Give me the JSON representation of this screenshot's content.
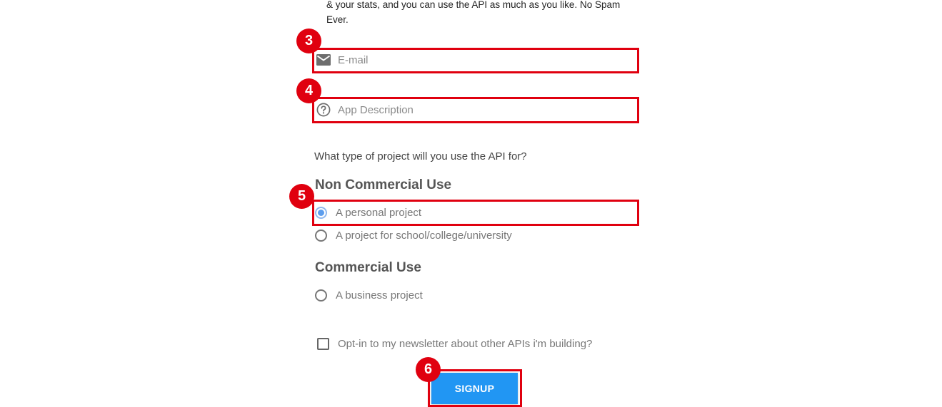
{
  "intro_text": "& your stats, and you can use the API as much as you like. No Spam Ever.",
  "form": {
    "email": {
      "placeholder": "E-mail",
      "value": ""
    },
    "app_description": {
      "placeholder": "App Description",
      "value": ""
    },
    "project_type_question": "What type of project will you use the API for?",
    "non_commercial": {
      "heading": "Non Commercial Use",
      "options": [
        {
          "label": "A personal project",
          "selected": true
        },
        {
          "label": "A project for school/college/university",
          "selected": false
        }
      ]
    },
    "commercial": {
      "heading": "Commercial Use",
      "options": [
        {
          "label": "A business project",
          "selected": false
        }
      ]
    },
    "newsletter_label": "Opt-in to my newsletter about other APIs i'm building?",
    "newsletter_checked": false,
    "signup_label": "SIGNUP"
  },
  "annotations": {
    "badges": [
      "3",
      "4",
      "5",
      "6"
    ],
    "color": "#e0000f"
  },
  "colors": {
    "accent": "#2196f3",
    "radio_selected": "#5c9ded"
  },
  "icons": {
    "email": "envelope-icon",
    "description": "question-circle-icon"
  }
}
